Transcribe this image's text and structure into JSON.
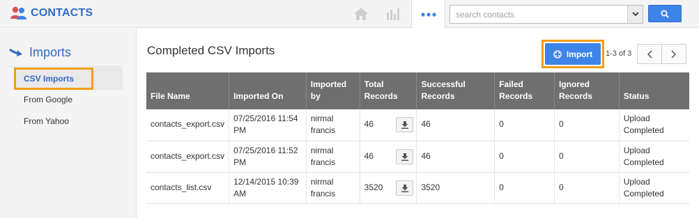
{
  "app": {
    "title": "CONTACTS"
  },
  "nav": {
    "home_icon": "home-icon",
    "stats_icon": "bar-chart-icon",
    "more_icon": "more-dots-icon"
  },
  "search": {
    "placeholder": "search contacts",
    "button_icon": "search-icon"
  },
  "sidebar": {
    "heading": "Imports",
    "items": [
      {
        "label": "CSV Imports",
        "active": true
      },
      {
        "label": "From Google",
        "active": false
      },
      {
        "label": "From Yahoo",
        "active": false
      }
    ]
  },
  "main": {
    "title": "Completed CSV Imports",
    "import_label": "Import",
    "paging": "1-3 of 3"
  },
  "table": {
    "headers": {
      "file_name": "File Name",
      "imported_on": "Imported On",
      "imported_by": "Imported by",
      "total_records": "Total Records",
      "successful_records": "Successful Records",
      "failed_records": "Failed Records",
      "ignored_records": "Ignored Records",
      "status": "Status"
    },
    "rows": [
      {
        "file_name": "contacts_export.csv",
        "imported_on": "07/25/2016 11:54 PM",
        "imported_by": "nirmal francis",
        "total": "46",
        "successful": "46",
        "failed": "0",
        "ignored": "0",
        "status": "Upload Completed"
      },
      {
        "file_name": "contacts_export.csv",
        "imported_on": "07/25/2016 11:52 PM",
        "imported_by": "nirmal francis",
        "total": "46",
        "successful": "46",
        "failed": "0",
        "ignored": "0",
        "status": "Upload Completed"
      },
      {
        "file_name": "contacts_list.csv",
        "imported_on": "12/14/2015 10:39 AM",
        "imported_by": "nirmal francis",
        "total": "3520",
        "successful": "3520",
        "failed": "0",
        "ignored": "0",
        "status": "Upload Completed"
      }
    ]
  },
  "colors": {
    "brand": "#2f6bc4",
    "primary_button": "#3e83e8",
    "highlight": "#f39c12",
    "table_header": "#6f6f6f"
  }
}
